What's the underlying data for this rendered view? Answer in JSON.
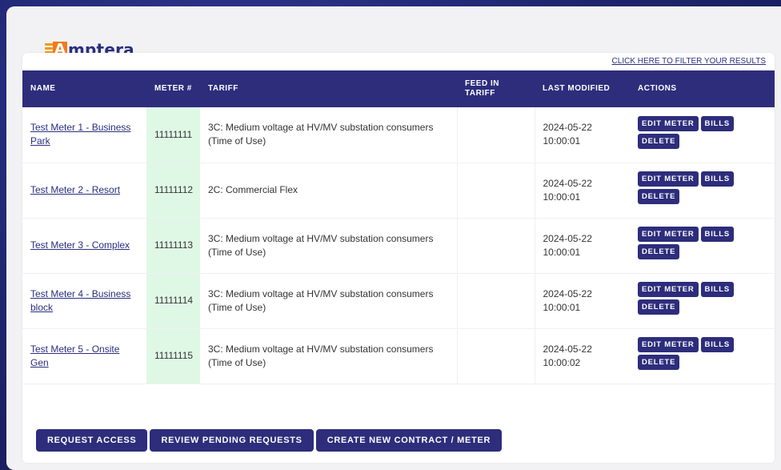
{
  "brand": {
    "logo_letter": "A",
    "logo_text": "mptera",
    "accent": "#f07b1c",
    "primary": "#2d2d7c"
  },
  "filter_link": "CLICK HERE TO FILTER YOUR RESULTS",
  "table": {
    "headers": {
      "name": "NAME",
      "meter": "METER #",
      "tariff": "TARIFF",
      "feed_in_line1": "FEED IN",
      "feed_in_line2": "TARIFF",
      "last_modified": "LAST MODIFIED",
      "actions": "ACTIONS"
    },
    "action_labels": {
      "edit": "EDIT METER",
      "bills": "BILLS",
      "delete": "DELETE"
    },
    "rows": [
      {
        "name": "Test Meter 1 - Business Park",
        "meter": "11111111",
        "tariff": "3C: Medium voltage at HV/MV substation consumers (Time of Use)",
        "feed_in": "",
        "date": "2024-05-22",
        "time": "10:00:01"
      },
      {
        "name": "Test Meter 2 - Resort",
        "meter": "11111112",
        "tariff": "2C: Commercial Flex",
        "feed_in": "",
        "date": "2024-05-22",
        "time": "10:00:01"
      },
      {
        "name": "Test Meter 3 - Complex",
        "meter": "11111113",
        "tariff": "3C: Medium voltage at HV/MV substation consumers (Time of Use)",
        "feed_in": "",
        "date": "2024-05-22",
        "time": "10:00:01"
      },
      {
        "name": "Test Meter 4 - Business block",
        "meter": "11111114",
        "tariff": "3C: Medium voltage at HV/MV substation consumers (Time of Use)",
        "feed_in": "",
        "date": "2024-05-22",
        "time": "10:00:01"
      },
      {
        "name": "Test Meter 5 - Onsite Gen",
        "meter": "11111115",
        "tariff": "3C: Medium voltage at HV/MV substation consumers (Time of Use)",
        "feed_in": "",
        "date": "2024-05-22",
        "time": "10:00:02"
      }
    ]
  },
  "bottom_buttons": {
    "request_access": "REQUEST ACCESS",
    "review_pending": "REVIEW PENDING REQUESTS",
    "create_new": "CREATE NEW CONTRACT / METER"
  }
}
